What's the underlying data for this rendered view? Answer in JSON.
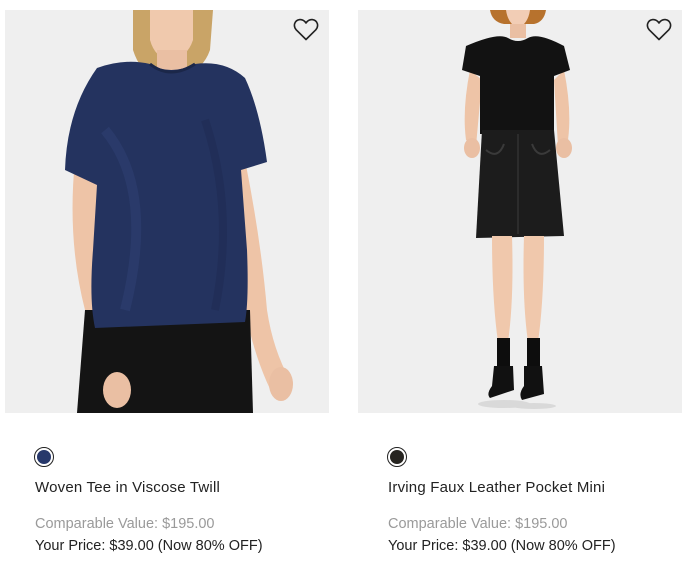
{
  "products": [
    {
      "name": "Woven Tee in Viscose Twill",
      "comparable_value": "Comparable Value: $195.00",
      "your_price": "Your Price: $39.00 (Now 80% OFF)",
      "swatch_color": "#27386b",
      "image_icon": "model-navy-tee-photo",
      "wishlist_icon": "heart-outline-icon"
    },
    {
      "name": "Irving Faux Leather Pocket Mini",
      "comparable_value": "Comparable Value: $195.00",
      "your_price": "Your Price: $39.00 (Now 80% OFF)",
      "swatch_color": "#262420",
      "image_icon": "model-leather-skirt-photo",
      "wishlist_icon": "heart-outline-icon"
    }
  ]
}
